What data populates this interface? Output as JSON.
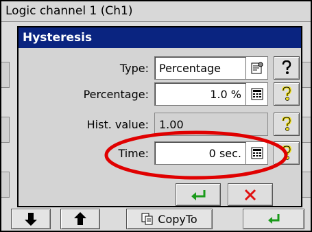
{
  "window": {
    "title": "Logic channel 1 (Ch1)"
  },
  "dialog": {
    "title": "Hysteresis",
    "fields": {
      "type": {
        "label": "Type:",
        "value": "Percentage"
      },
      "percentage": {
        "label": "Percentage:",
        "value": "1.0 %"
      },
      "hist_value": {
        "label": "Hist. value:",
        "value": "1.00"
      },
      "time": {
        "label": "Time:",
        "value": "0 sec."
      }
    }
  },
  "toolbar": {
    "copy_label": "CopyTo"
  },
  "colors": {
    "dialog_title_bg": "#0a2480",
    "ok_green": "#1a9a1a",
    "cancel_red": "#e01010",
    "highlight_red": "#e00000",
    "help_yellow": "#f0e020"
  },
  "icons": {
    "type_picker": "settings-list-icon",
    "percentage_picker": "calculator-icon",
    "time_picker": "calculator-icon",
    "help": "question-mark-icon",
    "ok": "enter-arrow-icon",
    "cancel": "red-x-icon",
    "toolbar_down": "arrow-down-icon",
    "toolbar_up": "arrow-up-icon",
    "toolbar_copy": "copy-icon",
    "toolbar_enter": "enter-arrow-icon"
  }
}
